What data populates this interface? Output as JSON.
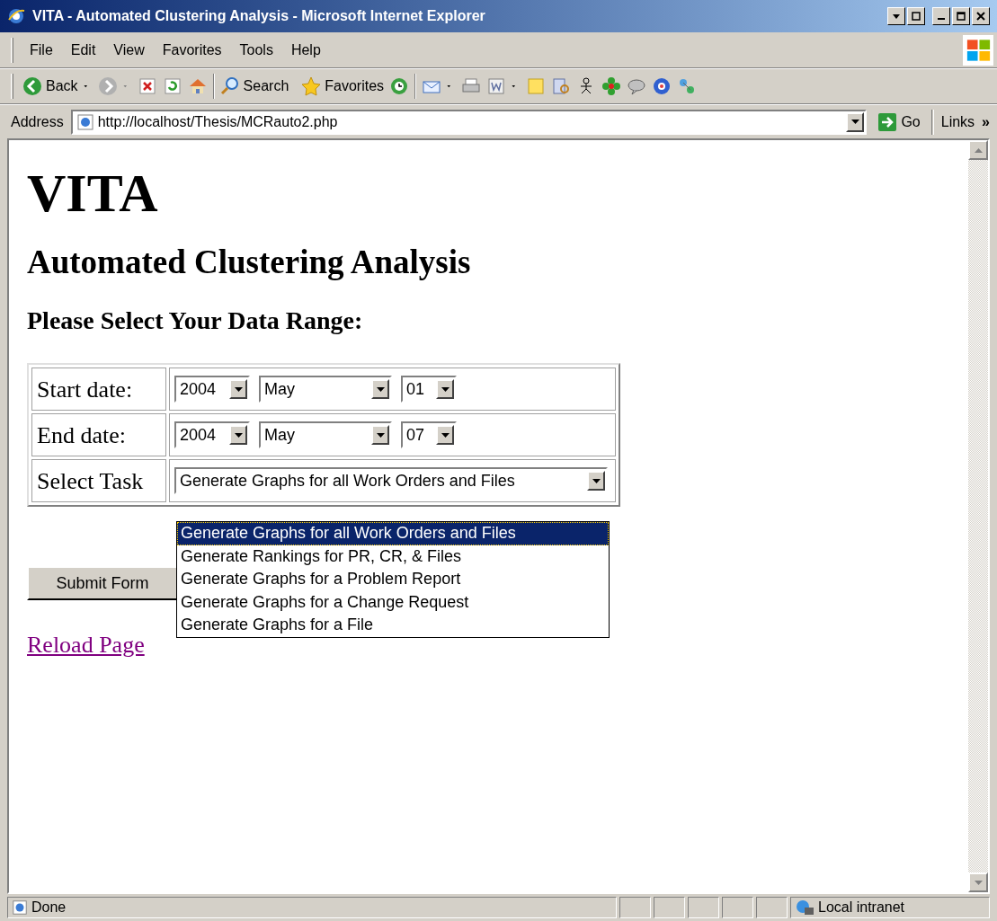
{
  "window": {
    "title": "VITA - Automated Clustering Analysis - Microsoft Internet Explorer"
  },
  "menu": [
    "File",
    "Edit",
    "View",
    "Favorites",
    "Tools",
    "Help"
  ],
  "toolbar": {
    "back": "Back",
    "search": "Search",
    "favorites": "Favorites"
  },
  "address_bar": {
    "label": "Address",
    "value": "http://localhost/Thesis/MCRauto2.php",
    "go": "Go",
    "links": "Links",
    "more": "»"
  },
  "page": {
    "title": "VITA",
    "subtitle": "Automated Clustering Analysis",
    "section": "Please Select Your Data Range:",
    "form": {
      "rows": [
        {
          "label": "Start date:",
          "year": "2004",
          "month": "May",
          "day": "01"
        },
        {
          "label": "End date:",
          "year": "2004",
          "month": "May",
          "day": "07"
        }
      ],
      "task": {
        "label": "Select Task",
        "value": "Generate Graphs for all Work Orders and Files",
        "expanded": true,
        "options": [
          {
            "label": "Generate Graphs for all Work Orders and Files",
            "selected": true
          },
          {
            "label": "Generate Rankings for PR, CR, & Files",
            "selected": false
          },
          {
            "label": "Generate Graphs for a Problem Report",
            "selected": false
          },
          {
            "label": "Generate Graphs for a Change Request",
            "selected": false
          },
          {
            "label": "Generate Graphs for a File",
            "selected": false
          }
        ]
      }
    },
    "submit": "Submit Form",
    "link": "Reload Page"
  },
  "status_bar": {
    "text": "Done",
    "zone": "Local intranet"
  }
}
